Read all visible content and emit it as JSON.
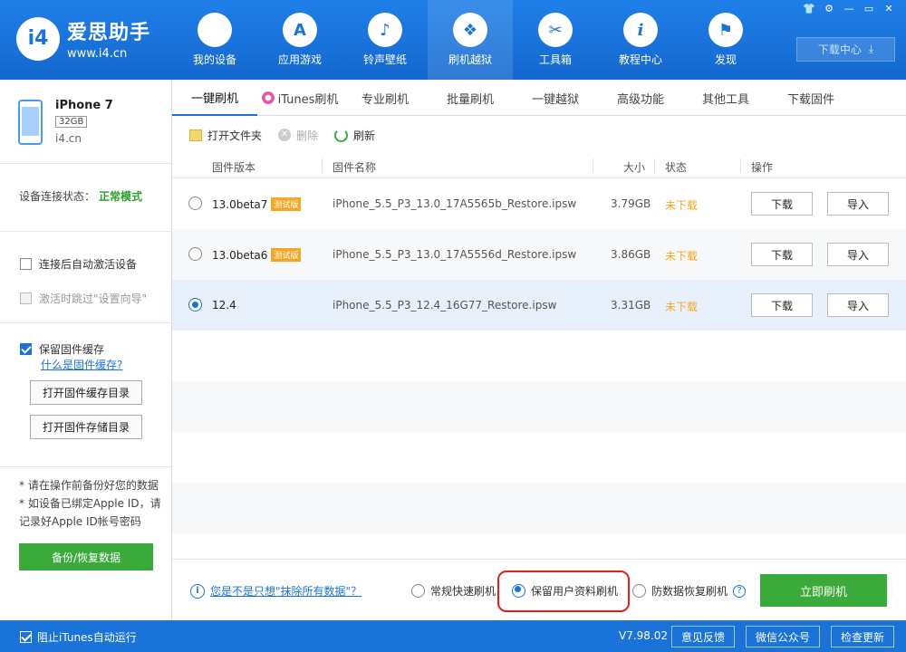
{
  "header": {
    "logo_mark": "i4",
    "logo_name": "爱思助手",
    "logo_url": "www.i4.cn",
    "nav": [
      {
        "label": "我的设备",
        "glyph": "",
        "icon": "apple-icon"
      },
      {
        "label": "应用游戏",
        "glyph": "A",
        "icon": "app-store-icon"
      },
      {
        "label": "铃声壁纸",
        "glyph": "♪",
        "icon": "ringtone-icon"
      },
      {
        "label": "刷机越狱",
        "glyph": "❖",
        "icon": "flash-box-icon"
      },
      {
        "label": "工具箱",
        "glyph": "✂",
        "icon": "tools-icon"
      },
      {
        "label": "教程中心",
        "glyph": "i",
        "icon": "info-icon"
      },
      {
        "label": "发现",
        "glyph": "⚑",
        "icon": "flag-icon"
      }
    ],
    "download_center": "下载中心",
    "window_controls": [
      "👕",
      "⚙",
      "—",
      "▭",
      "✕"
    ]
  },
  "sidebar": {
    "device_name": "iPhone 7",
    "device_storage": "32GB",
    "device_site": "i4.cn",
    "conn_label": "设备连接状态：",
    "conn_value": "正常模式",
    "opt_auto_activate": "连接后自动激活设备",
    "opt_skip_wizard": "激活时跳过\"设置向导\"",
    "opt_keep_cache": "保留固件缓存",
    "cache_help": "什么是固件缓存?",
    "btn_open_cache": "打开固件缓存目录",
    "btn_open_storage": "打开固件存储目录",
    "note1": "* 请在操作前备份好您的数据",
    "note2": "* 如设备已绑定Apple ID，请记录好Apple ID帐号密码",
    "btn_backup": "备份/恢复数据"
  },
  "tabs": [
    "一键刷机",
    "iTunes刷机",
    "专业刷机",
    "批量刷机",
    "一键越狱",
    "高级功能",
    "其他工具",
    "下载固件"
  ],
  "toolbar": {
    "open_folder": "打开文件夹",
    "delete": "删除",
    "refresh": "刷新"
  },
  "table": {
    "headers": {
      "version": "固件版本",
      "name": "固件名称",
      "size": "大小",
      "status": "状态",
      "action": "操作"
    },
    "rows": [
      {
        "version": "13.0beta7",
        "badge": "测试版",
        "name": "iPhone_5.5_P3_13.0_17A5565b_Restore.ipsw",
        "size": "3.79GB",
        "status": "未下载",
        "download": "下载",
        "import": "导入",
        "selected": false
      },
      {
        "version": "13.0beta6",
        "badge": "测试版",
        "name": "iPhone_5.5_P3_13.0_17A5556d_Restore.ipsw",
        "size": "3.86GB",
        "status": "未下载",
        "download": "下载",
        "import": "导入",
        "selected": false
      },
      {
        "version": "12.4",
        "badge": "",
        "name": "iPhone_5.5_P3_12.4_16G77_Restore.ipsw",
        "size": "3.31GB",
        "status": "未下载",
        "download": "下载",
        "import": "导入",
        "selected": true
      }
    ]
  },
  "bottom": {
    "info_link": "您是不是只想\"抹除所有数据\"？",
    "mode_quick": "常规快速刷机",
    "mode_keep": "保留用户资料刷机",
    "mode_anti": "防数据恢复刷机",
    "flash_now": "立即刷机"
  },
  "footer": {
    "block_itunes": "阻止iTunes自动运行",
    "version": "V7.98.02",
    "feedback": "意见反馈",
    "wechat": "微信公众号",
    "update": "检查更新"
  },
  "colors": {
    "brand": "#1a73d9",
    "green": "#3aab3a",
    "warning": "#f5a623",
    "highlight": "#e0201c"
  }
}
